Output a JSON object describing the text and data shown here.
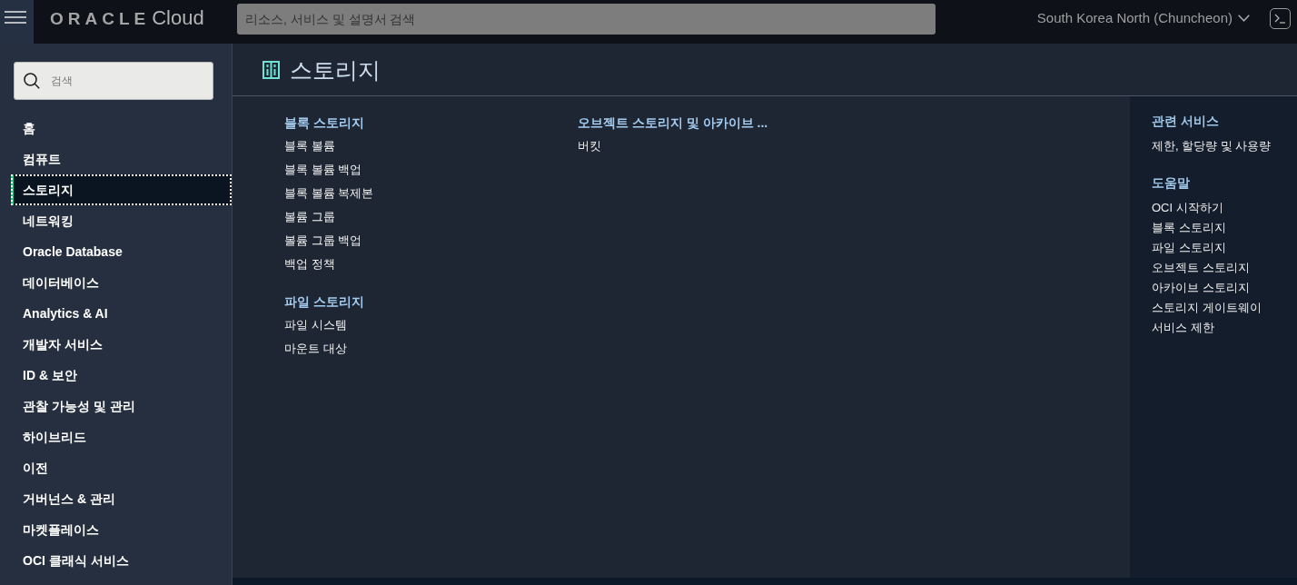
{
  "header": {
    "brand": {
      "logo": "ORACLE",
      "product": "Cloud"
    },
    "search": {
      "placeholder": "리소스, 서비스 및 설명서 검색"
    },
    "region": "South Korea North (Chuncheon)"
  },
  "sidebar": {
    "search": {
      "placeholder": "검색"
    },
    "items": [
      {
        "label": "홈",
        "selected": false
      },
      {
        "label": "컴퓨트",
        "selected": false
      },
      {
        "label": "스토리지",
        "selected": true
      },
      {
        "label": "네트워킹",
        "selected": false
      },
      {
        "label": "Oracle Database",
        "selected": false
      },
      {
        "label": "데이터베이스",
        "selected": false
      },
      {
        "label": "Analytics & AI",
        "selected": false
      },
      {
        "label": "개발자 서비스",
        "selected": false
      },
      {
        "label": "ID & 보안",
        "selected": false
      },
      {
        "label": "관찰 가능성 및 관리",
        "selected": false
      },
      {
        "label": "하이브리드",
        "selected": false
      },
      {
        "label": "이전",
        "selected": false
      },
      {
        "label": "거버넌스 & 관리",
        "selected": false
      },
      {
        "label": "마켓플레이스",
        "selected": false
      },
      {
        "label": "OCI 클래식 서비스",
        "selected": false
      }
    ]
  },
  "page": {
    "title": "스토리지",
    "columns": [
      {
        "groups": [
          {
            "heading": "블록 스토리지",
            "links": [
              "블록 볼륨",
              "블록 볼륨 백업",
              "블록 볼륨 복제본",
              "볼륨 그룹",
              "볼륨 그룹 백업",
              "백업 정책"
            ]
          },
          {
            "heading": "파일 스토리지",
            "links": [
              "파일 시스템",
              "마운트 대상"
            ]
          }
        ]
      },
      {
        "groups": [
          {
            "heading": "오브젝트 스토리지 및 아카이브 ...",
            "links": [
              "버킷"
            ]
          }
        ]
      }
    ]
  },
  "aside": {
    "groups": [
      {
        "heading": "관련 서비스",
        "links": [
          "제한, 할당량 및 사용량"
        ]
      },
      {
        "heading": "도움말",
        "links": [
          "OCI 시작하기",
          "블록 스토리지",
          "파일 스토리지",
          "오브젝트 스토리지",
          "아카이브 스토리지",
          "스토리지 게이트웨이",
          "서비스 제한"
        ]
      }
    ]
  }
}
